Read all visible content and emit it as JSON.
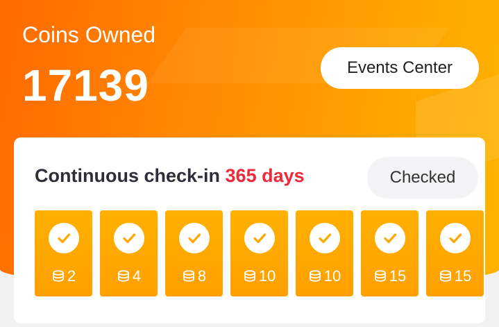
{
  "header": {
    "coins_label": "Coins Owned",
    "coins_value": "17139",
    "events_button": "Events Center"
  },
  "checkin": {
    "title_prefix": "Continuous check-in",
    "title_days": "365 days",
    "status_button": "Checked",
    "days": [
      {
        "reward": "2",
        "checked": true
      },
      {
        "reward": "4",
        "checked": true
      },
      {
        "reward": "8",
        "checked": true
      },
      {
        "reward": "10",
        "checked": true
      },
      {
        "reward": "10",
        "checked": true
      },
      {
        "reward": "15",
        "checked": true
      },
      {
        "reward": "15",
        "checked": true
      }
    ]
  },
  "colors": {
    "accent_orange": "#ff7a00",
    "day_box": "#ffa800",
    "days_highlight": "#ee2a3a"
  },
  "icons": {
    "check": "check-icon",
    "coin": "coin-stack-icon"
  }
}
